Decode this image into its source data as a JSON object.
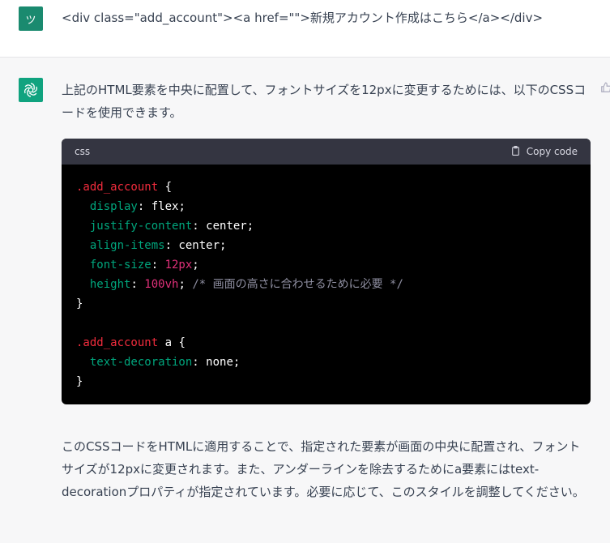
{
  "user": {
    "avatar_letter": "ツ",
    "message": "<div class=\"add_account\"><a href=\"\">新規アカウント作成はこちら</a></div>"
  },
  "assistant": {
    "intro": "上記のHTML要素を中央に配置して、フォントサイズを12pxに変更するためには、以下のCSSコードを使用できます。",
    "code": {
      "language": "css",
      "copy_label": "Copy code",
      "lines": [
        [
          {
            "t": ".add_account",
            "c": "selector"
          },
          {
            "t": " {",
            "c": "plain"
          }
        ],
        [
          {
            "t": "  ",
            "c": "plain"
          },
          {
            "t": "display",
            "c": "prop"
          },
          {
            "t": ": flex;",
            "c": "plain"
          }
        ],
        [
          {
            "t": "  ",
            "c": "plain"
          },
          {
            "t": "justify-content",
            "c": "prop"
          },
          {
            "t": ": center;",
            "c": "plain"
          }
        ],
        [
          {
            "t": "  ",
            "c": "plain"
          },
          {
            "t": "align-items",
            "c": "prop"
          },
          {
            "t": ": center;",
            "c": "plain"
          }
        ],
        [
          {
            "t": "  ",
            "c": "plain"
          },
          {
            "t": "font-size",
            "c": "prop"
          },
          {
            "t": ": ",
            "c": "plain"
          },
          {
            "t": "12px",
            "c": "num"
          },
          {
            "t": ";",
            "c": "plain"
          }
        ],
        [
          {
            "t": "  ",
            "c": "plain"
          },
          {
            "t": "height",
            "c": "prop"
          },
          {
            "t": ": ",
            "c": "plain"
          },
          {
            "t": "100vh",
            "c": "num"
          },
          {
            "t": "; ",
            "c": "plain"
          },
          {
            "t": "/* 画面の高さに合わせるために必要 */",
            "c": "comment"
          }
        ],
        [
          {
            "t": "}",
            "c": "plain"
          }
        ],
        [
          {
            "t": "",
            "c": "plain"
          }
        ],
        [
          {
            "t": ".add_account",
            "c": "selector"
          },
          {
            "t": " a {",
            "c": "plain"
          }
        ],
        [
          {
            "t": "  ",
            "c": "plain"
          },
          {
            "t": "text-decoration",
            "c": "prop"
          },
          {
            "t": ": none;",
            "c": "plain"
          }
        ],
        [
          {
            "t": "}",
            "c": "plain"
          }
        ]
      ]
    },
    "outro": "このCSSコードをHTMLに適用することで、指定された要素が画面の中央に配置され、フォントサイズが12pxに変更されます。また、アンダーラインを除去するためにa要素にはtext-decorationプロパティが指定されています。必要に応じて、このスタイルを調整してください。"
  },
  "colors": {
    "user_avatar": "#1a8a6f",
    "assistant_avatar": "#10a37f",
    "code_bg": "#000000",
    "code_header_bg": "#343541",
    "selector": "#f22c3d",
    "property": "#00a67d",
    "number": "#df3079",
    "comment": "#8e8ea0"
  },
  "icons": {
    "assistant_avatar": "openai-logo-icon",
    "copy": "clipboard-icon",
    "feedback": "thumbs-up-icon"
  }
}
